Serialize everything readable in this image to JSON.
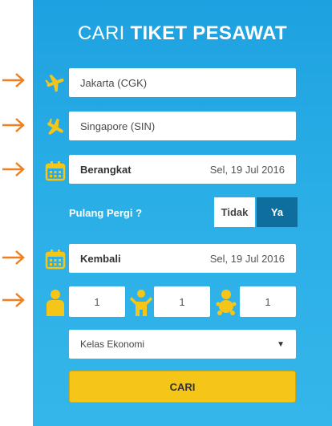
{
  "header": {
    "title_light": "CARI",
    "title_bold": "TIKET PESAWAT"
  },
  "form": {
    "origin": "Jakarta (CGK)",
    "destination": "Singapore (SIN)",
    "departure": {
      "label": "Berangkat",
      "date": "Sel, 19 Jul 2016"
    },
    "round_trip": {
      "label": "Pulang Pergi ?",
      "no": "Tidak",
      "yes": "Ya",
      "selected": "Ya"
    },
    "return": {
      "label": "Kembali",
      "date": "Sel, 19 Jul 2016"
    },
    "passengers": {
      "adult": "1",
      "child": "1",
      "infant": "1"
    },
    "cabin_class": "Kelas Ekonomi",
    "submit": "CARI"
  },
  "icons": {
    "arrow": "arrow-right-icon",
    "departure": "plane-takeoff-icon",
    "arrival": "plane-landing-icon",
    "calendar": "calendar-icon",
    "adult": "adult-icon",
    "child": "child-icon",
    "infant": "infant-icon"
  },
  "colors": {
    "panel": "#2aaee6",
    "arrow": "#f07f1e",
    "icon": "#f5c518",
    "toggle_active": "#0e6f9e",
    "button": "#f5c518"
  }
}
